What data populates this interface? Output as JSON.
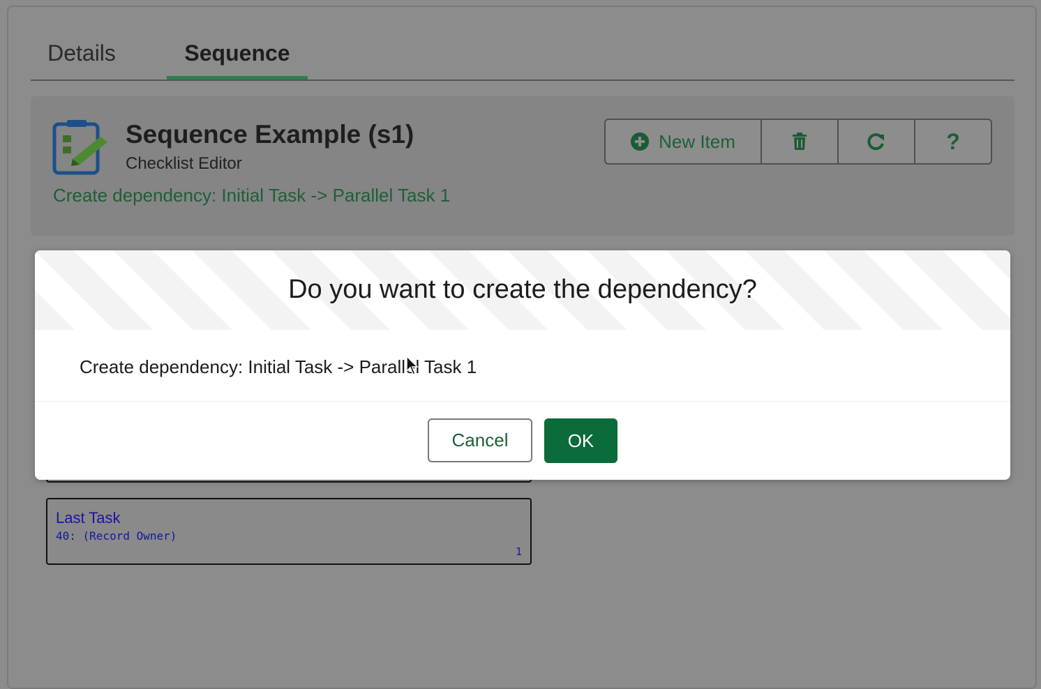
{
  "tabs": [
    {
      "label": "Details",
      "active": false
    },
    {
      "label": "Sequence",
      "active": true
    }
  ],
  "header": {
    "title": "Sequence Example (s1)",
    "subtitle": "Checklist Editor",
    "status": "Create dependency: Initial Task -> Parallel Task 1",
    "icon": "checklist-editor-icon"
  },
  "toolbar": {
    "new_item_label": "New Item",
    "new_item_icon": "plus-circle-icon",
    "delete_icon": "trash-icon",
    "refresh_icon": "refresh-icon",
    "help_label": "?"
  },
  "tasks": [
    {
      "name": "Last Task",
      "owner": "40: (Record Owner)",
      "count": "1"
    }
  ],
  "dialog": {
    "title": "Do you want to create the dependency?",
    "message": "Create dependency: Initial Task -> Parallel Task 1",
    "cancel_label": "Cancel",
    "ok_label": "OK"
  },
  "colors": {
    "accent": "#0b6b3a",
    "overlay": "#8c8c8c",
    "task_text": "#1616a0"
  }
}
